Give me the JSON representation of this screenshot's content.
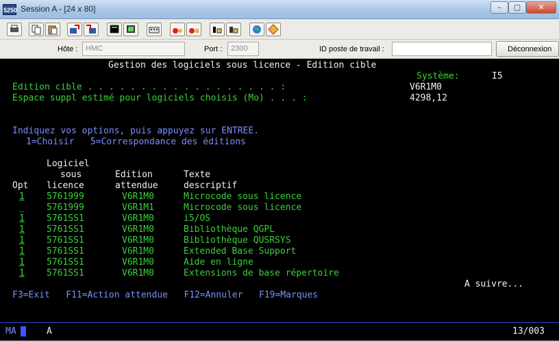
{
  "window": {
    "icon_text": "5250",
    "title": "Session A - [24 x 80]",
    "buttons": {
      "minimize": "–",
      "maximize": "▢",
      "close": "✕"
    }
  },
  "toolbar": {
    "icons": [
      "print-screen-icon",
      "copy-icon",
      "paste-icon",
      "send-file-icon",
      "receive-file-icon",
      "display-icon",
      "keypad-icon",
      "macro-icon",
      "record-icon",
      "play-macro-icon",
      "stop-macro-icon",
      "globe-icon",
      "help-icon"
    ]
  },
  "connection": {
    "host_label": "Hôte :",
    "host_value": "HMC",
    "port_label": "Port :",
    "port_value": "2300",
    "workstation_label": "ID poste de travail :",
    "workstation_value": "",
    "disconnect_label": "Déconnexion"
  },
  "screen": {
    "title": "Gestion des logiciels sous licence - Edition cible",
    "system_label": "Système:",
    "system_value": "I5",
    "target_edition_label": "Edition cible . . . . . . . . . . . . . . . . . . :",
    "target_edition_value": "V6R1M0",
    "space_label": "Espace suppl estimé pour logiciels choisis (Mo) . . . :",
    "space_value": "4298,12",
    "instructions": "Indiquez vos options, puis appuyez sur ENTREE.",
    "options": "1=Choisir   5=Correspondance des éditions",
    "headers": {
      "licence_1": "Logiciel",
      "licence_2": "sous",
      "licence_3": "licence",
      "edition_1": "Edition",
      "edition_2": "attendue",
      "texte_1": "Texte",
      "texte_2": "descriptif",
      "opt": "Opt"
    },
    "rows": [
      {
        "opt": "1",
        "product": "5761999",
        "edition": "V6R1M0",
        "text": "Microcode sous licence"
      },
      {
        "opt": "_",
        "product": "5761999",
        "edition": "V6R1M1",
        "text": "Microcode sous licence"
      },
      {
        "opt": "1",
        "product": "5761SS1",
        "edition": "V6R1M0",
        "text": "i5/OS"
      },
      {
        "opt": "1",
        "product": "5761SS1",
        "edition": "V6R1M0",
        "text": "Bibliothèque QGPL"
      },
      {
        "opt": "1",
        "product": "5761SS1",
        "edition": "V6R1M0",
        "text": "Bibliothèque QUSRSYS"
      },
      {
        "opt": "1",
        "product": "5761SS1",
        "edition": "V6R1M0",
        "text": "Extended Base Support"
      },
      {
        "opt": "1",
        "product": "5761SS1",
        "edition": "V6R1M0",
        "text": "Aide en ligne"
      },
      {
        "opt": "1",
        "product": "5761SS1",
        "edition": "V6R1M0",
        "text": "Extensions de base répertoire"
      }
    ],
    "more": "A suivre...",
    "function_keys": "F3=Exit   F11=Action attendue   F12=Annuler   F19=Marques"
  },
  "status": {
    "mode": "MA",
    "indicator": "A",
    "cursor_position": "13/003"
  }
}
